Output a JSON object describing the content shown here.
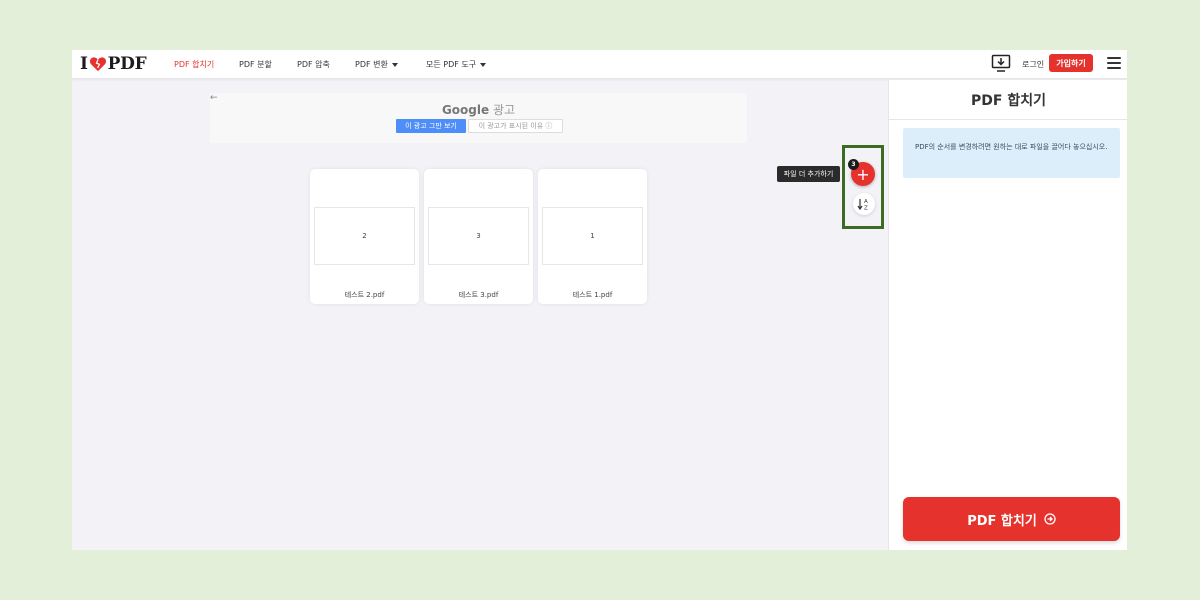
{
  "header": {
    "logo": {
      "left": "I",
      "right": "PDF"
    },
    "nav": [
      {
        "label": "PDF 합치기",
        "active": true
      },
      {
        "label": "PDF 분할",
        "active": false
      },
      {
        "label": "PDF 압축",
        "active": false
      },
      {
        "label": "PDF 변환",
        "active": false,
        "dropdown": true
      },
      {
        "label": "모든 PDF 도구",
        "active": false,
        "dropdown": true
      }
    ],
    "login_label": "로그인",
    "signup_label": "가입하기"
  },
  "ad": {
    "back_glyph": "←",
    "brand": "Google",
    "label": "광고",
    "stop_label": "이 광고 그만 보기",
    "why_label": "이 광고가 표시된 이유 ⓘ"
  },
  "files": [
    {
      "page": "2",
      "name": "테스트 2.pdf"
    },
    {
      "page": "3",
      "name": "테스트 3.pdf"
    },
    {
      "page": "1",
      "name": "테스트 1.pdf"
    }
  ],
  "actions": {
    "add_tooltip": "파일 더 추가하기",
    "file_count": "3",
    "add_glyph": "+",
    "sort_label": "↓A Z"
  },
  "sidebar": {
    "title": "PDF 합치기",
    "info": "PDF의 순서를 변경하려면 원하는 대로 파일을 끌어다 놓으십시오.",
    "merge_label": "PDF 합치기"
  },
  "colors": {
    "brand_red": "#e5322d",
    "info_bg": "#ddeefb",
    "highlight_border": "#3e6b23",
    "page_bg": "#e3efd9"
  },
  "icons": [
    "heart-logo-icon",
    "desktop-download-icon",
    "hamburger-menu-icon",
    "plus-icon",
    "sort-az-icon",
    "arrow-circle-right-icon",
    "back-arrow-icon"
  ]
}
